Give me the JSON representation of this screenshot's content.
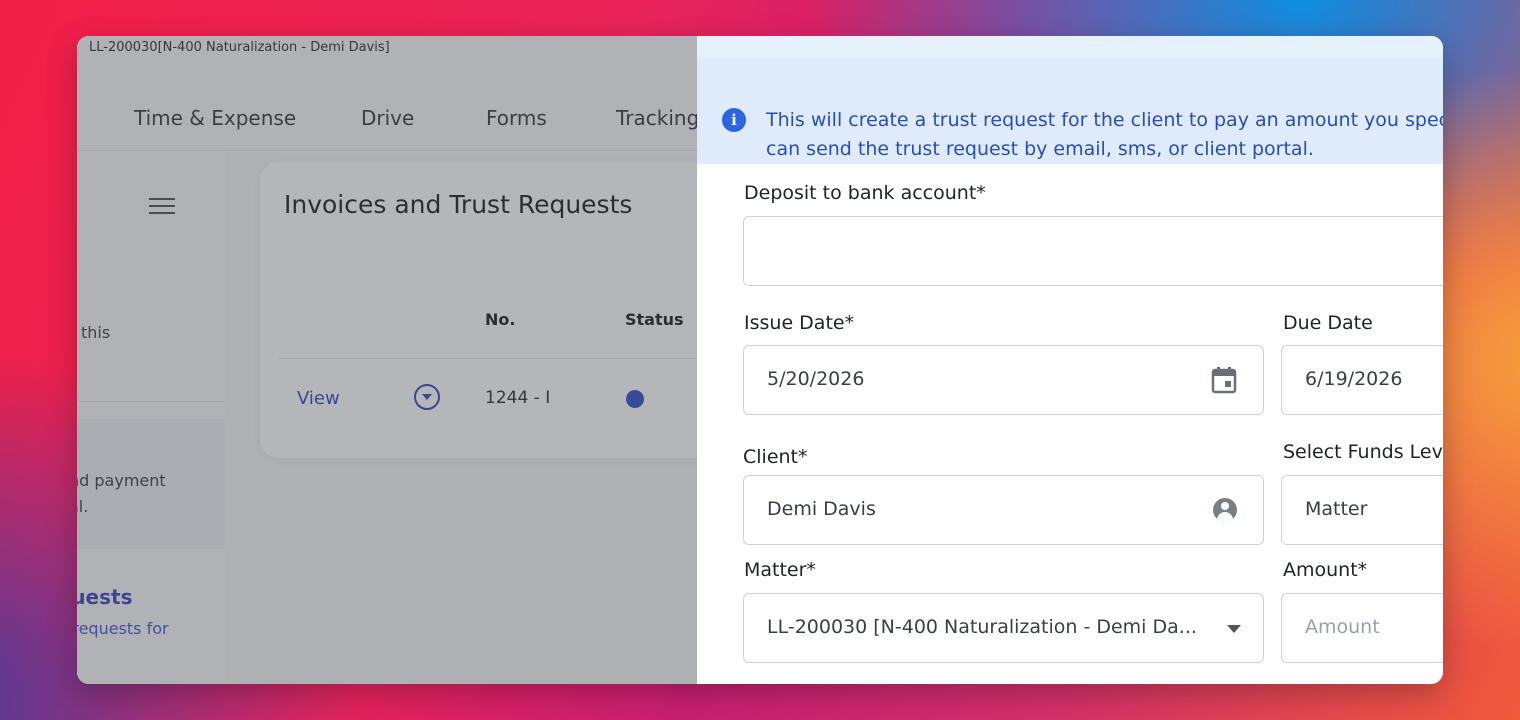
{
  "window": {
    "title": "LL-200030[N-400 Naturalization - Demi Davis]"
  },
  "nav": {
    "items": [
      "Time & Expense",
      "Drive",
      "Forms",
      "Tracking"
    ]
  },
  "left_panel": {
    "text_1": "this",
    "text_2": "nd payment",
    "text_3": "al.",
    "link": "quests",
    "sub": "t requests for"
  },
  "card": {
    "title": "Invoices and Trust Requests",
    "columns": [
      "No.",
      "Status"
    ],
    "row": {
      "action": "View",
      "number": "1244 - I"
    }
  },
  "drawer": {
    "info": {
      "line1": "This will create a trust request for the client to pay an amount you spec",
      "line2": "can send the trust request by email, sms, or client portal."
    },
    "deposit": {
      "label": "Deposit to bank account*",
      "value": ""
    },
    "issue_date": {
      "label": "Issue Date*",
      "value": "5/20/2026"
    },
    "due_date": {
      "label": "Due Date",
      "value": "6/19/2026"
    },
    "client": {
      "label": "Client*",
      "value": "Demi Davis"
    },
    "funds_level": {
      "label": "Select Funds Lev",
      "value": "Matter"
    },
    "matter": {
      "label": "Matter*",
      "value": "LL-200030 [N-400 Naturalization - Demi Da..."
    },
    "amount": {
      "label": "Amount*",
      "placeholder": "Amount"
    }
  },
  "icons": {
    "info": "info-icon",
    "calendar": "calendar-icon",
    "person": "person-icon",
    "dropdown": "chevron-down-icon",
    "menu": "hamburger-icon"
  },
  "colors": {
    "accent": "#3b4bc8",
    "banner_bg": "#dfeafb",
    "banner_text": "#2a4fb4"
  }
}
